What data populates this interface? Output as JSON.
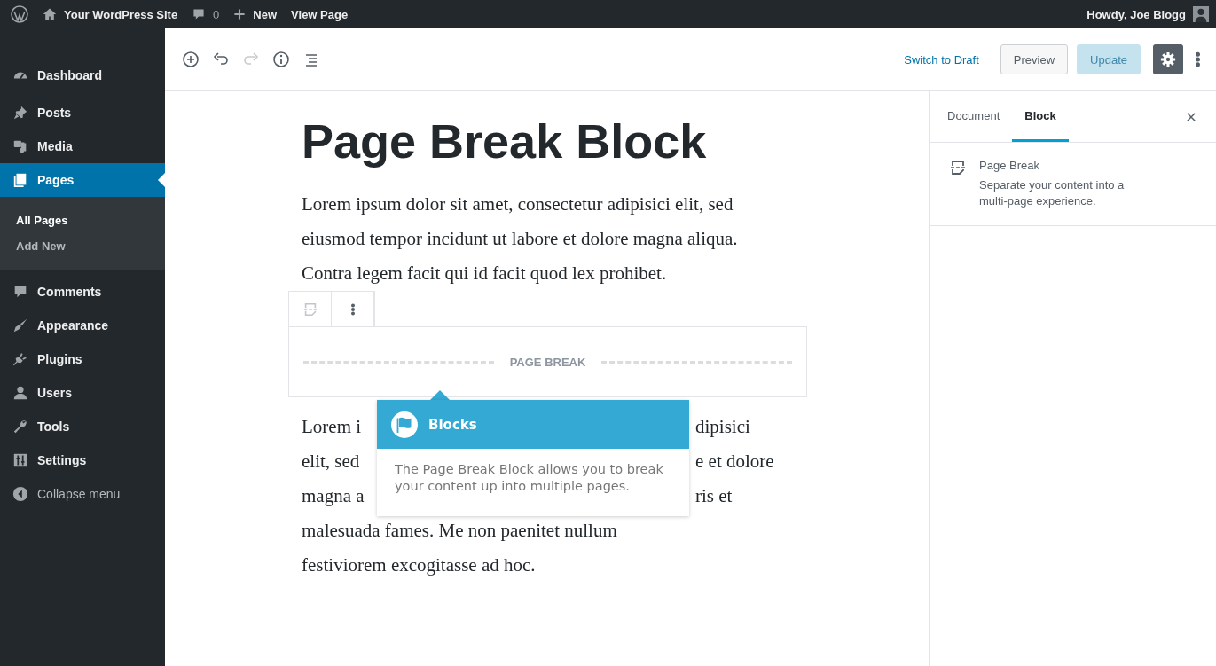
{
  "admin_bar": {
    "site": "Your WordPress Site",
    "comments": "0",
    "new": "New",
    "view": "View Page",
    "greeting": "Howdy, Joe Blogg"
  },
  "menu": {
    "items": [
      {
        "label": "Dashboard",
        "kind": "dashboard",
        "selected": false
      },
      {
        "label": "Posts",
        "kind": "pin",
        "selected": false
      },
      {
        "label": "Media",
        "kind": "media",
        "selected": false
      },
      {
        "label": "Pages",
        "kind": "pages",
        "selected": true,
        "children": [
          {
            "label": "All Pages",
            "selected": true
          },
          {
            "label": "Add New",
            "selected": false
          }
        ]
      },
      {
        "label": "Comments",
        "kind": "comment",
        "selected": false
      },
      {
        "label": "Appearance",
        "kind": "brush",
        "selected": false
      },
      {
        "label": "Plugins",
        "kind": "plug",
        "selected": false
      },
      {
        "label": "Users",
        "kind": "user",
        "selected": false
      },
      {
        "label": "Tools",
        "kind": "wrench",
        "selected": false
      },
      {
        "label": "Settings",
        "kind": "sliders",
        "selected": false
      }
    ],
    "collapse": "Collapse menu"
  },
  "toolbar": {
    "tools": [
      {
        "kind": "add",
        "disabled": false
      },
      {
        "kind": "undo",
        "disabled": false
      },
      {
        "kind": "redo",
        "disabled": true
      },
      {
        "kind": "info",
        "disabled": false
      },
      {
        "kind": "outline",
        "disabled": false
      }
    ],
    "switch_draft": "Switch to Draft",
    "preview": "Preview",
    "update": {
      "label": "Update",
      "disabled": true
    },
    "settings_active": true
  },
  "post": {
    "title": "Page Break Block",
    "paragraph_1": "Lorem ipsum dolor sit amet, consectetur adipisici elit, sed eiusmod tempor incidunt ut labore et dolore magna aliqua. Contra legem facit qui id facit quod lex prohibet.",
    "page_break": "PAGE BREAK",
    "paragraph_2_lines": [
      {
        "left": "Lorem i",
        "right": "dipisici"
      },
      {
        "left": "elit, sed",
        "right": "e et dolore"
      },
      {
        "left": "magna a",
        "right": "ris et"
      },
      {
        "text": "malesuada fames. Me non paenitet nullum"
      },
      {
        "text": "festiviorem excogitasse ad hoc."
      }
    ]
  },
  "tooltip": {
    "title": "Blocks",
    "body": "The Page Break Block allows you to break your content up into multiple pages."
  },
  "panel": {
    "tabs": [
      {
        "label": "Document",
        "selected": false
      },
      {
        "label": "Block",
        "selected": true
      }
    ],
    "block": {
      "name": "Page Break",
      "description": "Separate your content into a multi-page experience."
    }
  }
}
